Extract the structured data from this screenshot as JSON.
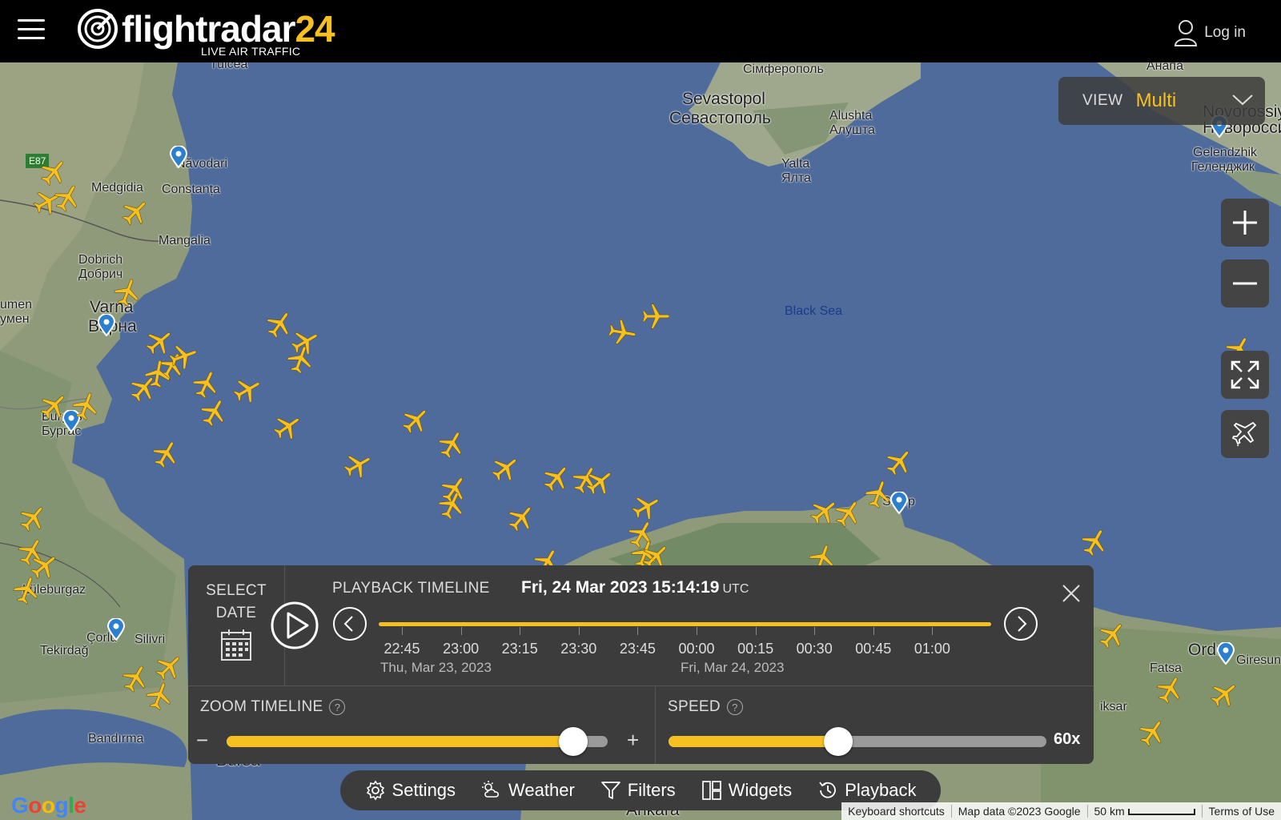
{
  "header": {
    "logo_main": "flightradar",
    "logo_num": "24",
    "logo_tagline": "LIVE AIR TRAFFIC",
    "login_label": "Log in"
  },
  "view": {
    "label": "VIEW",
    "value": "Multi"
  },
  "map_labels": {
    "simferopol": "Сімферополь",
    "sevastopol": "Sevastopol",
    "sevastopol_cyr": "Севастополь",
    "alushta": "Alushta",
    "alushta_cyr": "Алушта",
    "yalta": "Yalta",
    "yalta_cyr": "Ялта",
    "novorossiysk": "Novorossiys",
    "novorossiysk_cyr": "Новоросси",
    "gelendzhik": "Gelendzhik",
    "gelendzhik_cyr": "Геленджик",
    "anapa": "Анапа",
    "navodari": "Năvodari",
    "medgidia": "Medgidia",
    "constanta": "Constanța",
    "mangalia": "Mangalia",
    "dobrich": "Dobrich",
    "dobrich_cyr": "Добрич",
    "varna": "Varna",
    "varna_cyr": "Варна",
    "shumen": "umen",
    "shumen_cyr": "умен",
    "burgas": "Burgas",
    "burgas_cyr": "Бургас",
    "black_sea": "Black Sea",
    "sinop": "Sinop",
    "luleburgaz": "Lüleburgaz",
    "corlu": "Çorlu",
    "tekirdag": "Tekirdağ",
    "silivri": "Silivri",
    "bandirma": "Bandırma",
    "bursa": "Bursa",
    "ankara": "Ankara",
    "ordu": "Ordu",
    "giresun": "Giresun",
    "fatsa": "Fatsa",
    "niksar": "iksar",
    "road_e87": "E87",
    "tulcea": "Tulcea"
  },
  "playback": {
    "select_date_line1": "SELECT",
    "select_date_line2": "DATE",
    "title": "PLAYBACK TIMELINE",
    "datetime": "Fri, 24 Mar 2023 15:14:19",
    "tz": "UTC",
    "times": [
      "22:45",
      "23:00",
      "23:15",
      "23:30",
      "23:45",
      "00:00",
      "00:15",
      "00:30",
      "00:45",
      "01:00"
    ],
    "date_left": "Thu, Mar 23, 2023",
    "date_right": "Fri, Mar 24, 2023",
    "zoom_title": "ZOOM TIMELINE",
    "zoom_level": 0.91,
    "zoom_minus": "−",
    "zoom_plus": "+",
    "speed_title": "SPEED",
    "speed_level": 0.45,
    "speed_value": "60x",
    "help": "?"
  },
  "toolbar": {
    "settings": "Settings",
    "weather": "Weather",
    "filters": "Filters",
    "widgets": "Widgets",
    "playback": "Playback"
  },
  "attribution": {
    "shortcuts": "Keyboard shortcuts",
    "mapdata": "Map data ©2023 Google",
    "scale": "50 km",
    "terms": "Terms of Use"
  },
  "google_logo": "Google",
  "colors": {
    "accent": "#f7c021",
    "sea": "#4f6b9b",
    "panel": "#3c3c3c"
  }
}
